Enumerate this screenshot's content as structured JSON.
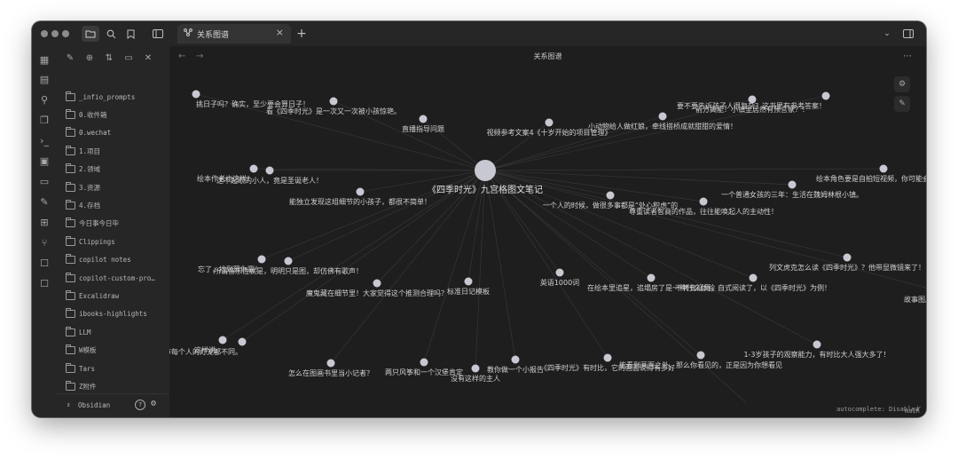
{
  "tab": {
    "title": "关系图谱"
  },
  "header": {
    "title": "关系图谱"
  },
  "sidebar": {
    "folders": [
      "_infio_prompts",
      "0.收件箱",
      "0.wechat",
      "1.项目",
      "2.领域",
      "3.资源",
      "4.存档",
      "今日事今日毕",
      "Clippings",
      "copilot notes",
      "copilot-custom-pro…",
      "Excalidraw",
      "ibooks-highlights",
      "LLM",
      "W模板",
      "Tars",
      "Z附件"
    ],
    "vault_name": "Obsidian"
  },
  "status_bar": {
    "autocomplete": "autocomplete: Disabled",
    "branch": "main"
  },
  "graph": {
    "center_label": "《四季时光》九宫格图文笔记",
    "nodes": [
      "挑日子吗？确实，至少要会算日子！",
      "看《四季时光》是一次又一次被小孩惊艳。",
      "直播指导问题",
      "视频参考文案4《十岁开始的项目管理》",
      "小动物给人做红娘，牵线搭桥成就甜甜的爱情！",
      "前方高能！小镇里居然有预言家？！",
      "要不要告诉孩子人很复杂？这书里有参考答案！",
      "绘本作者也这样！",
      "这不起眼的小人，竟是圣诞老人！",
      "能独立发现这组细节的小孩子，都很不简单！",
      "一个人的时候，做很多事都是“处心积虑”的",
      "尊重读者智商的作品，往往能唤起人的主动性！",
      "一个普通女孩的三年：生活在魏姆林根小镇。",
      "绘本角色要是自拍短视频，你可能会看到这",
      "忘了，找到算你赢！",
      "所谓音乐性就是，明明只是图，却仿佛有歌声！",
      "魔鬼藏在细节里！大家觉得这个推测合理吗？",
      "标准日记模板",
      "英语1000词",
      "在绘本里追星，追塌房了是一种什么体验",
      "不转变视角，自式阅读了，以《四季时光》为例！",
      "列文虎克怎么读《四季时光》？他带显微镜来了！",
      "故事图层",
      "这样讲。",
      "录：灯笼节每个人的灯笼都不同。",
      "怎么在图画书里当小记者？",
      "两只风筝和一个汉堡肯定",
      "没有这样的主人",
      "教你做一个小报告",
      "《四季时光》有时比，它的画面说得有多好",
      "能看到画面之外，那么你看见的，正是因为你想看见",
      "1-3岁孩子的观察能力，有时比大人强大多了！"
    ]
  }
}
